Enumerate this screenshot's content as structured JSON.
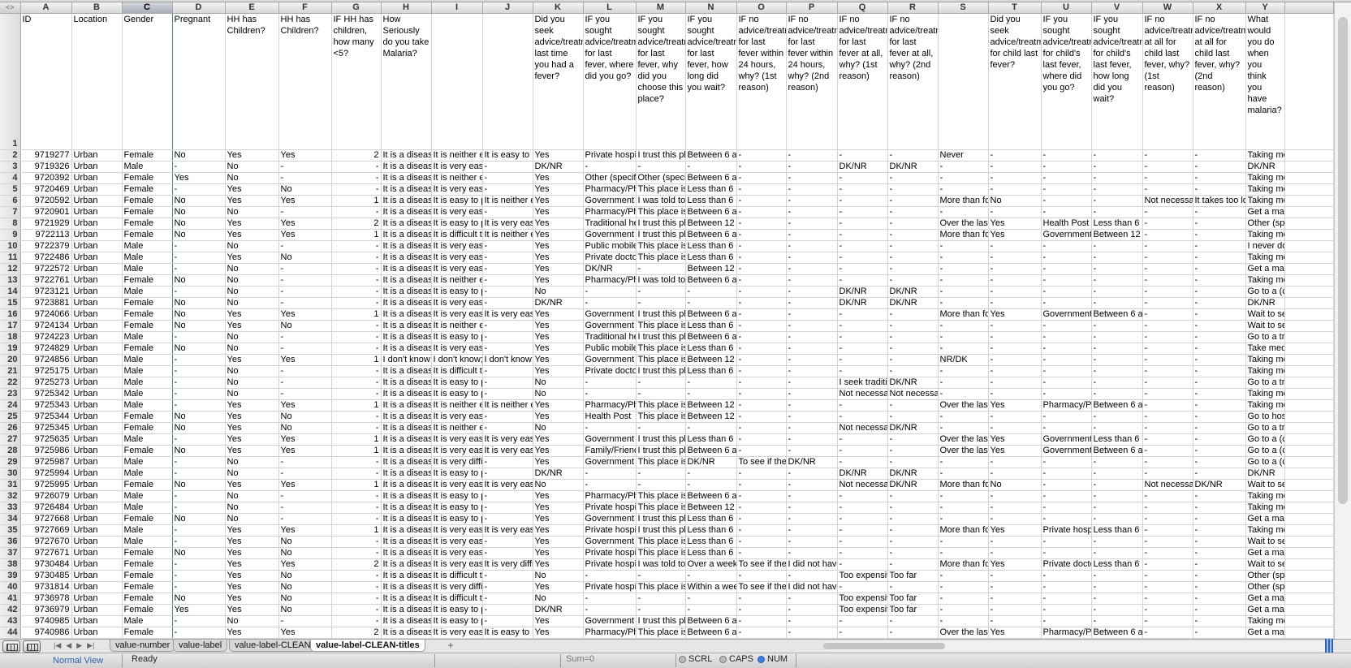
{
  "columns": [
    "A",
    "B",
    "C",
    "D",
    "E",
    "F",
    "G",
    "H",
    "I",
    "J",
    "K",
    "L",
    "M",
    "N",
    "O",
    "P",
    "Q",
    "R",
    "S",
    "T",
    "U",
    "V",
    "W",
    "X",
    "Y"
  ],
  "corner": "<>",
  "header_row": [
    "ID",
    "Location",
    "Gender",
    "Pregnant",
    "HH has Children?",
    "HH has Children?",
    "IF HH has children, how many <5?",
    "How Seriously do you take Malaria?",
    "",
    "",
    "Did you seek advice/treatment last time you had a fever?",
    "IF you sought advice/treatment for last fever, where did you go?",
    "IF you sought advice/treatment for last fever, why did you choose this place?",
    "IF you sought advice/treatment for last fever, how long did you wait?",
    "IF no advice/treatment for last fever within 24 hours, why? (1st reason)",
    "IF no advice/treatment for last fever within 24 hours, why? (2nd reason)",
    "IF no advice/treatment for last fever at all, why? (1st reason)",
    "IF no advice/treatment for last fever at all, why? (2nd reason)",
    "",
    "Did you seek advice/treatment for child last fever?",
    "IF you sought advice/treatment for child's last fever, where did you go?",
    "IF you sought advice/treatment for child's last fever, how long did you wait?",
    "IF no advice/treatment at all for child last fever, why? (1st reason)",
    "IF no advice/treatment at all for child last fever, why? (2nd reason)",
    "What would you do when you think you have malaria?"
  ],
  "rows": [
    [
      "9719277",
      "Urban",
      "Female",
      "No",
      "Yes",
      "Yes",
      "2",
      "It is a disease",
      "It is neither ea",
      "It is easy to pr",
      "Yes",
      "Private hospit",
      "I trust this pla",
      "Between 6 an",
      "-",
      "-",
      "-",
      "-",
      "Never",
      "-",
      "-",
      "-",
      "-",
      "-",
      "Taking medi"
    ],
    [
      "9719326",
      "Urban",
      "Male",
      "-",
      "No",
      "-",
      "-",
      "It is a disease",
      "It is very easy",
      "-",
      "DK/NR",
      "-",
      "-",
      "-",
      "-",
      "-",
      "DK/NR",
      "DK/NR",
      "-",
      "-",
      "-",
      "-",
      "-",
      "-",
      "DK/NR"
    ],
    [
      "9720392",
      "Urban",
      "Female",
      "Yes",
      "No",
      "-",
      "-",
      "It is a disease",
      "It is neither ea",
      "-",
      "Yes",
      "Other (specify",
      "Other (specify",
      "Between 6 an",
      "-",
      "-",
      "-",
      "-",
      "-",
      "-",
      "-",
      "-",
      "-",
      "-",
      "Taking medi"
    ],
    [
      "9720469",
      "Urban",
      "Female",
      "-",
      "Yes",
      "No",
      "-",
      "It is a disease",
      "It is very easy",
      "-",
      "Yes",
      "Pharmacy/Pha",
      "This place is cl",
      "Less than 6 hr",
      "-",
      "-",
      "-",
      "-",
      "-",
      "-",
      "-",
      "-",
      "-",
      "-",
      "Taking medi"
    ],
    [
      "9720592",
      "Urban",
      "Female",
      "No",
      "Yes",
      "Yes",
      "1",
      "It is a disease",
      "It is easy to pr",
      "It is neither ea",
      "Yes",
      "Government H",
      "I was told to g",
      "Less than 6 hr",
      "-",
      "-",
      "-",
      "-",
      "More than fou",
      "No",
      "-",
      "-",
      "Not necessary",
      "It takes too lo",
      "Taking medi"
    ],
    [
      "9720901",
      "Urban",
      "Female",
      "No",
      "No",
      "-",
      "-",
      "It is a disease",
      "It is very easy",
      "-",
      "Yes",
      "Pharmacy/Pha",
      "This place is cl",
      "Between 6 an",
      "-",
      "-",
      "-",
      "-",
      "-",
      "-",
      "-",
      "-",
      "-",
      "-",
      "Get a malari"
    ],
    [
      "9721929",
      "Urban",
      "Female",
      "No",
      "Yes",
      "Yes",
      "2",
      "It is a disease",
      "It is easy to pr",
      "It is very easy",
      "Yes",
      "Traditional he",
      "I trust this pla",
      "Between 12 a",
      "-",
      "-",
      "-",
      "-",
      "Over the last t",
      "Yes",
      "Health Post",
      "Less than 6 hr",
      "-",
      "-",
      "Other (speci"
    ],
    [
      "9722113",
      "Urban",
      "Female",
      "No",
      "Yes",
      "Yes",
      "1",
      "It is a disease",
      "It is difficult to",
      "It is neither ea",
      "Yes",
      "Government H",
      "I trust this pla",
      "Between 6 an",
      "-",
      "-",
      "-",
      "-",
      "More than fou",
      "Yes",
      "Government H",
      "Between 12 a",
      "-",
      "-",
      "Taking medi"
    ],
    [
      "9722379",
      "Urban",
      "Male",
      "-",
      "No",
      "-",
      "-",
      "It is a disease",
      "It is very easy",
      "-",
      "Yes",
      "Public mobile",
      "This place is w",
      "Less than 6 hr",
      "-",
      "-",
      "-",
      "-",
      "-",
      "-",
      "-",
      "-",
      "-",
      "-",
      "I never do an"
    ],
    [
      "9722486",
      "Urban",
      "Male",
      "-",
      "Yes",
      "No",
      "-",
      "It is a disease",
      "It is very easy",
      "-",
      "Yes",
      "Private doctor",
      "This place is cl",
      "Less than 6 hr",
      "-",
      "-",
      "-",
      "-",
      "-",
      "-",
      "-",
      "-",
      "-",
      "-",
      "Taking medi"
    ],
    [
      "9722572",
      "Urban",
      "Male",
      "-",
      "No",
      "-",
      "-",
      "It is a disease",
      "It is very easy",
      "-",
      "Yes",
      "DK/NR",
      "-",
      "Between 12 a",
      "-",
      "-",
      "-",
      "-",
      "-",
      "-",
      "-",
      "-",
      "-",
      "-",
      "Get a malari"
    ],
    [
      "9722761",
      "Urban",
      "Female",
      "No",
      "No",
      "-",
      "-",
      "It is a disease",
      "It is neither ea",
      "-",
      "Yes",
      "Pharmacy/Pha",
      "I was told to g",
      "Between 6 an",
      "-",
      "-",
      "-",
      "-",
      "-",
      "-",
      "-",
      "-",
      "-",
      "-",
      "Taking medi"
    ],
    [
      "9723121",
      "Urban",
      "Male",
      "-",
      "No",
      "-",
      "-",
      "It is a disease",
      "It is easy to pr",
      "-",
      "No",
      "-",
      "-",
      "-",
      "-",
      "-",
      "DK/NR",
      "DK/NR",
      "-",
      "-",
      "-",
      "-",
      "-",
      "-",
      "Go to a (che"
    ],
    [
      "9723881",
      "Urban",
      "Female",
      "No",
      "No",
      "-",
      "-",
      "It is a disease",
      "It is very easy",
      "-",
      "DK/NR",
      "-",
      "-",
      "-",
      "-",
      "-",
      "DK/NR",
      "DK/NR",
      "-",
      "-",
      "-",
      "-",
      "-",
      "-",
      "DK/NR"
    ],
    [
      "9724066",
      "Urban",
      "Female",
      "No",
      "Yes",
      "Yes",
      "1",
      "It is a disease",
      "It is very easy",
      "It is very easy",
      "Yes",
      "Government H",
      "I trust this pla",
      "Between 6 an",
      "-",
      "-",
      "-",
      "-",
      "More than fou",
      "Yes",
      "Government H",
      "Between 6 an",
      "-",
      "-",
      "Wait to see i"
    ],
    [
      "9724134",
      "Urban",
      "Female",
      "No",
      "Yes",
      "No",
      "-",
      "It is a disease",
      "It is neither ea",
      "-",
      "Yes",
      "Government H",
      "This place is in",
      "Less than 6 hr",
      "-",
      "-",
      "-",
      "-",
      "-",
      "-",
      "-",
      "-",
      "-",
      "-",
      "Wait to see i"
    ],
    [
      "9724223",
      "Urban",
      "Male",
      "-",
      "No",
      "-",
      "-",
      "It is a disease",
      "It is easy to pr",
      "-",
      "Yes",
      "Traditional he",
      "I trust this pla",
      "Between 6 an",
      "-",
      "-",
      "-",
      "-",
      "-",
      "-",
      "-",
      "-",
      "-",
      "-",
      "Go to a tradi"
    ],
    [
      "9724829",
      "Urban",
      "Female",
      "No",
      "No",
      "-",
      "-",
      "It is a disease",
      "It is very easy",
      "-",
      "Yes",
      "Public mobile",
      "This place is cl",
      "Less than 6 hr",
      "-",
      "-",
      "-",
      "-",
      "-",
      "-",
      "-",
      "-",
      "-",
      "-",
      "Take medi"
    ],
    [
      "9724856",
      "Urban",
      "Male",
      "-",
      "Yes",
      "Yes",
      "1",
      "I don't know;",
      "I don't know;",
      "I don't know;",
      "Yes",
      "Government H",
      "This place is in",
      "Between 12 a",
      "-",
      "-",
      "-",
      "-",
      "NR/DK",
      "-",
      "-",
      "-",
      "-",
      "-",
      "Taking medi"
    ],
    [
      "9725175",
      "Urban",
      "Male",
      "-",
      "No",
      "-",
      "-",
      "It is a disease",
      "It is difficult to",
      "-",
      "Yes",
      "Private doctor",
      "I trust this pla",
      "Less than 6 hr",
      "-",
      "-",
      "-",
      "-",
      "-",
      "-",
      "-",
      "-",
      "-",
      "-",
      "Taking medi"
    ],
    [
      "9725273",
      "Urban",
      "Male",
      "-",
      "No",
      "-",
      "-",
      "It is a disease",
      "It is easy to pr",
      "-",
      "No",
      "-",
      "-",
      "-",
      "-",
      "-",
      "I seek traditio",
      "DK/NR",
      "-",
      "-",
      "-",
      "-",
      "-",
      "-",
      "Go to a tradi"
    ],
    [
      "9725342",
      "Urban",
      "Male",
      "-",
      "No",
      "-",
      "-",
      "It is a disease",
      "It is easy to pr",
      "-",
      "No",
      "-",
      "-",
      "-",
      "-",
      "-",
      "Not necessary",
      "Not necessary",
      "-",
      "-",
      "-",
      "-",
      "-",
      "-",
      "Taking medi"
    ],
    [
      "9725343",
      "Urban",
      "Male",
      "-",
      "Yes",
      "Yes",
      "1",
      "It is a disease",
      "It is neither ea",
      "It is neither ea",
      "Yes",
      "Pharmacy/Pha",
      "This place is cl",
      "Between 12 a",
      "-",
      "-",
      "-",
      "-",
      "Over the last t",
      "Yes",
      "Pharmacy/Pha",
      "Between 6 an",
      "-",
      "-",
      "Taking medi"
    ],
    [
      "9725344",
      "Urban",
      "Female",
      "No",
      "Yes",
      "No",
      "-",
      "It is a disease",
      "It is very easy",
      "-",
      "Yes",
      "Health Post",
      "This place is w",
      "Between 12 a",
      "-",
      "-",
      "-",
      "-",
      "-",
      "-",
      "-",
      "-",
      "-",
      "-",
      "Go to hospit"
    ],
    [
      "9725345",
      "Urban",
      "Female",
      "No",
      "Yes",
      "No",
      "-",
      "It is a disease",
      "It is neither ea",
      "-",
      "No",
      "-",
      "-",
      "-",
      "-",
      "-",
      "Not necessary",
      "DK/NR",
      "-",
      "-",
      "-",
      "-",
      "-",
      "-",
      "Go to a tradi"
    ],
    [
      "9725635",
      "Urban",
      "Male",
      "-",
      "Yes",
      "Yes",
      "1",
      "It is a disease",
      "It is very easy",
      "It is very easy",
      "Yes",
      "Government H",
      "I trust this pla",
      "Less than 6 hr",
      "-",
      "-",
      "-",
      "-",
      "Over the last t",
      "Yes",
      "Government H",
      "Less than 6 hr",
      "-",
      "-",
      "Go to a (che"
    ],
    [
      "9725986",
      "Urban",
      "Female",
      "No",
      "Yes",
      "Yes",
      "1",
      "It is a disease",
      "It is very easy",
      "It is very easy",
      "Yes",
      "Family/Friend",
      "I trust this pla",
      "Between 6 an",
      "-",
      "-",
      "-",
      "-",
      "Over the last t",
      "Yes",
      "Government H",
      "Between 6 an",
      "-",
      "-",
      "Go to a (che"
    ],
    [
      "9725987",
      "Urban",
      "Male",
      "-",
      "No",
      "-",
      "-",
      "It is a disease",
      "It is very diffic",
      "-",
      "Yes",
      "Government H",
      "This place is cl",
      "DK/NR",
      "To see if the f",
      "DK/NR",
      "-",
      "-",
      "-",
      "-",
      "-",
      "-",
      "-",
      "-",
      "Go to a (che"
    ],
    [
      "9725994",
      "Urban",
      "Male",
      "-",
      "No",
      "-",
      "-",
      "It is a disease",
      "It is easy to pr",
      "-",
      "DK/NR",
      "-",
      "-",
      "-",
      "-",
      "-",
      "DK/NR",
      "DK/NR",
      "-",
      "-",
      "-",
      "-",
      "-",
      "-",
      "DK/NR"
    ],
    [
      "9725995",
      "Urban",
      "Female",
      "No",
      "Yes",
      "Yes",
      "1",
      "It is a disease",
      "It is very easy",
      "It is very easy",
      "No",
      "-",
      "-",
      "-",
      "-",
      "-",
      "Not necessary",
      "DK/NR",
      "More than fou",
      "No",
      "-",
      "-",
      "Not necessary",
      "DK/NR",
      "Wait to see i"
    ],
    [
      "9726079",
      "Urban",
      "Male",
      "-",
      "No",
      "-",
      "-",
      "It is a disease",
      "It is easy to pr",
      "-",
      "Yes",
      "Pharmacy/Pha",
      "This place is cl",
      "Between 6 an",
      "-",
      "-",
      "-",
      "-",
      "-",
      "-",
      "-",
      "-",
      "-",
      "-",
      "Taking medi"
    ],
    [
      "9726484",
      "Urban",
      "Male",
      "-",
      "No",
      "-",
      "-",
      "It is a disease",
      "It is easy to pr",
      "-",
      "Yes",
      "Private hospit",
      "This place is cl",
      "Between 12 a",
      "-",
      "-",
      "-",
      "-",
      "-",
      "-",
      "-",
      "-",
      "-",
      "-",
      "Taking medi"
    ],
    [
      "9727668",
      "Urban",
      "Female",
      "No",
      "No",
      "-",
      "-",
      "It is a disease",
      "It is easy to pr",
      "-",
      "Yes",
      "Government H",
      "I trust this pla",
      "Less than 6 hr",
      "-",
      "-",
      "-",
      "-",
      "-",
      "-",
      "-",
      "-",
      "-",
      "-",
      "Get a malari"
    ],
    [
      "9727669",
      "Urban",
      "Male",
      "-",
      "Yes",
      "Yes",
      "1",
      "It is a disease",
      "It is very easy",
      "It is very easy",
      "Yes",
      "Private hospit",
      "I trust this pla",
      "Less than 6 hr",
      "-",
      "-",
      "-",
      "-",
      "More than fou",
      "Yes",
      "Private hospit",
      "Less than 6 hr",
      "-",
      "-",
      "Taking medi"
    ],
    [
      "9727670",
      "Urban",
      "Male",
      "-",
      "Yes",
      "No",
      "-",
      "It is a disease",
      "It is very easy",
      "-",
      "Yes",
      "Government H",
      "This place is in",
      "Less than 6 hr",
      "-",
      "-",
      "-",
      "-",
      "-",
      "-",
      "-",
      "-",
      "-",
      "-",
      "Wait to see i"
    ],
    [
      "9727671",
      "Urban",
      "Female",
      "No",
      "Yes",
      "No",
      "-",
      "It is a disease",
      "It is very easy",
      "-",
      "Yes",
      "Private hospit",
      "This place is w",
      "Less than 6 hr",
      "-",
      "-",
      "-",
      "-",
      "-",
      "-",
      "-",
      "-",
      "-",
      "-",
      "Get a malari"
    ],
    [
      "9730484",
      "Urban",
      "Female",
      "-",
      "Yes",
      "Yes",
      "2",
      "It is a disease",
      "It is very easy",
      "It is very diffic",
      "Yes",
      "Private hospit",
      "I was told to g",
      "Over a week l",
      "To see if the f",
      "I did not have",
      "-",
      "-",
      "More than fou",
      "Yes",
      "Private doctor",
      "Less than 6 hr",
      "-",
      "-",
      "Wait to see i"
    ],
    [
      "9730485",
      "Urban",
      "Female",
      "-",
      "Yes",
      "No",
      "-",
      "It is a disease",
      "It is difficult to",
      "-",
      "No",
      "-",
      "-",
      "-",
      "-",
      "-",
      "Too expensive",
      "Too far",
      "-",
      "-",
      "-",
      "-",
      "-",
      "-",
      "Other (speci"
    ],
    [
      "9731814",
      "Urban",
      "Female",
      "-",
      "Yes",
      "No",
      "-",
      "It is a disease",
      "It is very diffic",
      "-",
      "Yes",
      "Private hospit",
      "This place is cl",
      "Within a week",
      "To see if the f",
      "I did not have",
      "-",
      "-",
      "-",
      "-",
      "-",
      "-",
      "-",
      "-",
      "Other (speci"
    ],
    [
      "9736978",
      "Urban",
      "Female",
      "No",
      "Yes",
      "No",
      "-",
      "It is a disease",
      "It is difficult to",
      "-",
      "No",
      "-",
      "-",
      "-",
      "-",
      "-",
      "Too expensive",
      "Too far",
      "-",
      "-",
      "-",
      "-",
      "-",
      "-",
      "Get a malari"
    ],
    [
      "9736979",
      "Urban",
      "Female",
      "Yes",
      "Yes",
      "No",
      "-",
      "It is a disease",
      "It is easy to pr",
      "-",
      "DK/NR",
      "-",
      "-",
      "-",
      "-",
      "-",
      "Too expensive",
      "Too far",
      "-",
      "-",
      "-",
      "-",
      "-",
      "-",
      "Get a malari"
    ],
    [
      "9740985",
      "Urban",
      "Male",
      "-",
      "No",
      "-",
      "-",
      "It is a disease",
      "It is easy to pr",
      "-",
      "Yes",
      "Government H",
      "I trust this pla",
      "Between 6 an",
      "-",
      "-",
      "-",
      "-",
      "-",
      "-",
      "-",
      "-",
      "-",
      "-",
      "Taking medi"
    ],
    [
      "9740986",
      "Urban",
      "Female",
      "-",
      "Yes",
      "Yes",
      "2",
      "It is a disease",
      "It is very easy",
      "It is easy to pr",
      "Yes",
      "Pharmacy/Pha",
      "This place is w",
      "Between 6 an",
      "-",
      "-",
      "-",
      "-",
      "Over the last t",
      "Yes",
      "Pharmacy/Pha",
      "Between 6 an",
      "-",
      "-",
      "Get a malari"
    ]
  ],
  "sheet_tabs": [
    "value-number",
    "value-label",
    "value-label-CLEAN",
    "value-label-CLEAN-titles"
  ],
  "active_tab": "value-label-CLEAN-titles",
  "selected_column": "C",
  "status": {
    "view": "Normal View",
    "ready": "Ready",
    "sum": "Sum=0",
    "scrl": "SCRL",
    "caps": "CAPS",
    "num": "NUM"
  },
  "colors": {
    "selection": "#4a7fc8",
    "num_lock_on": "#3b7de0"
  }
}
